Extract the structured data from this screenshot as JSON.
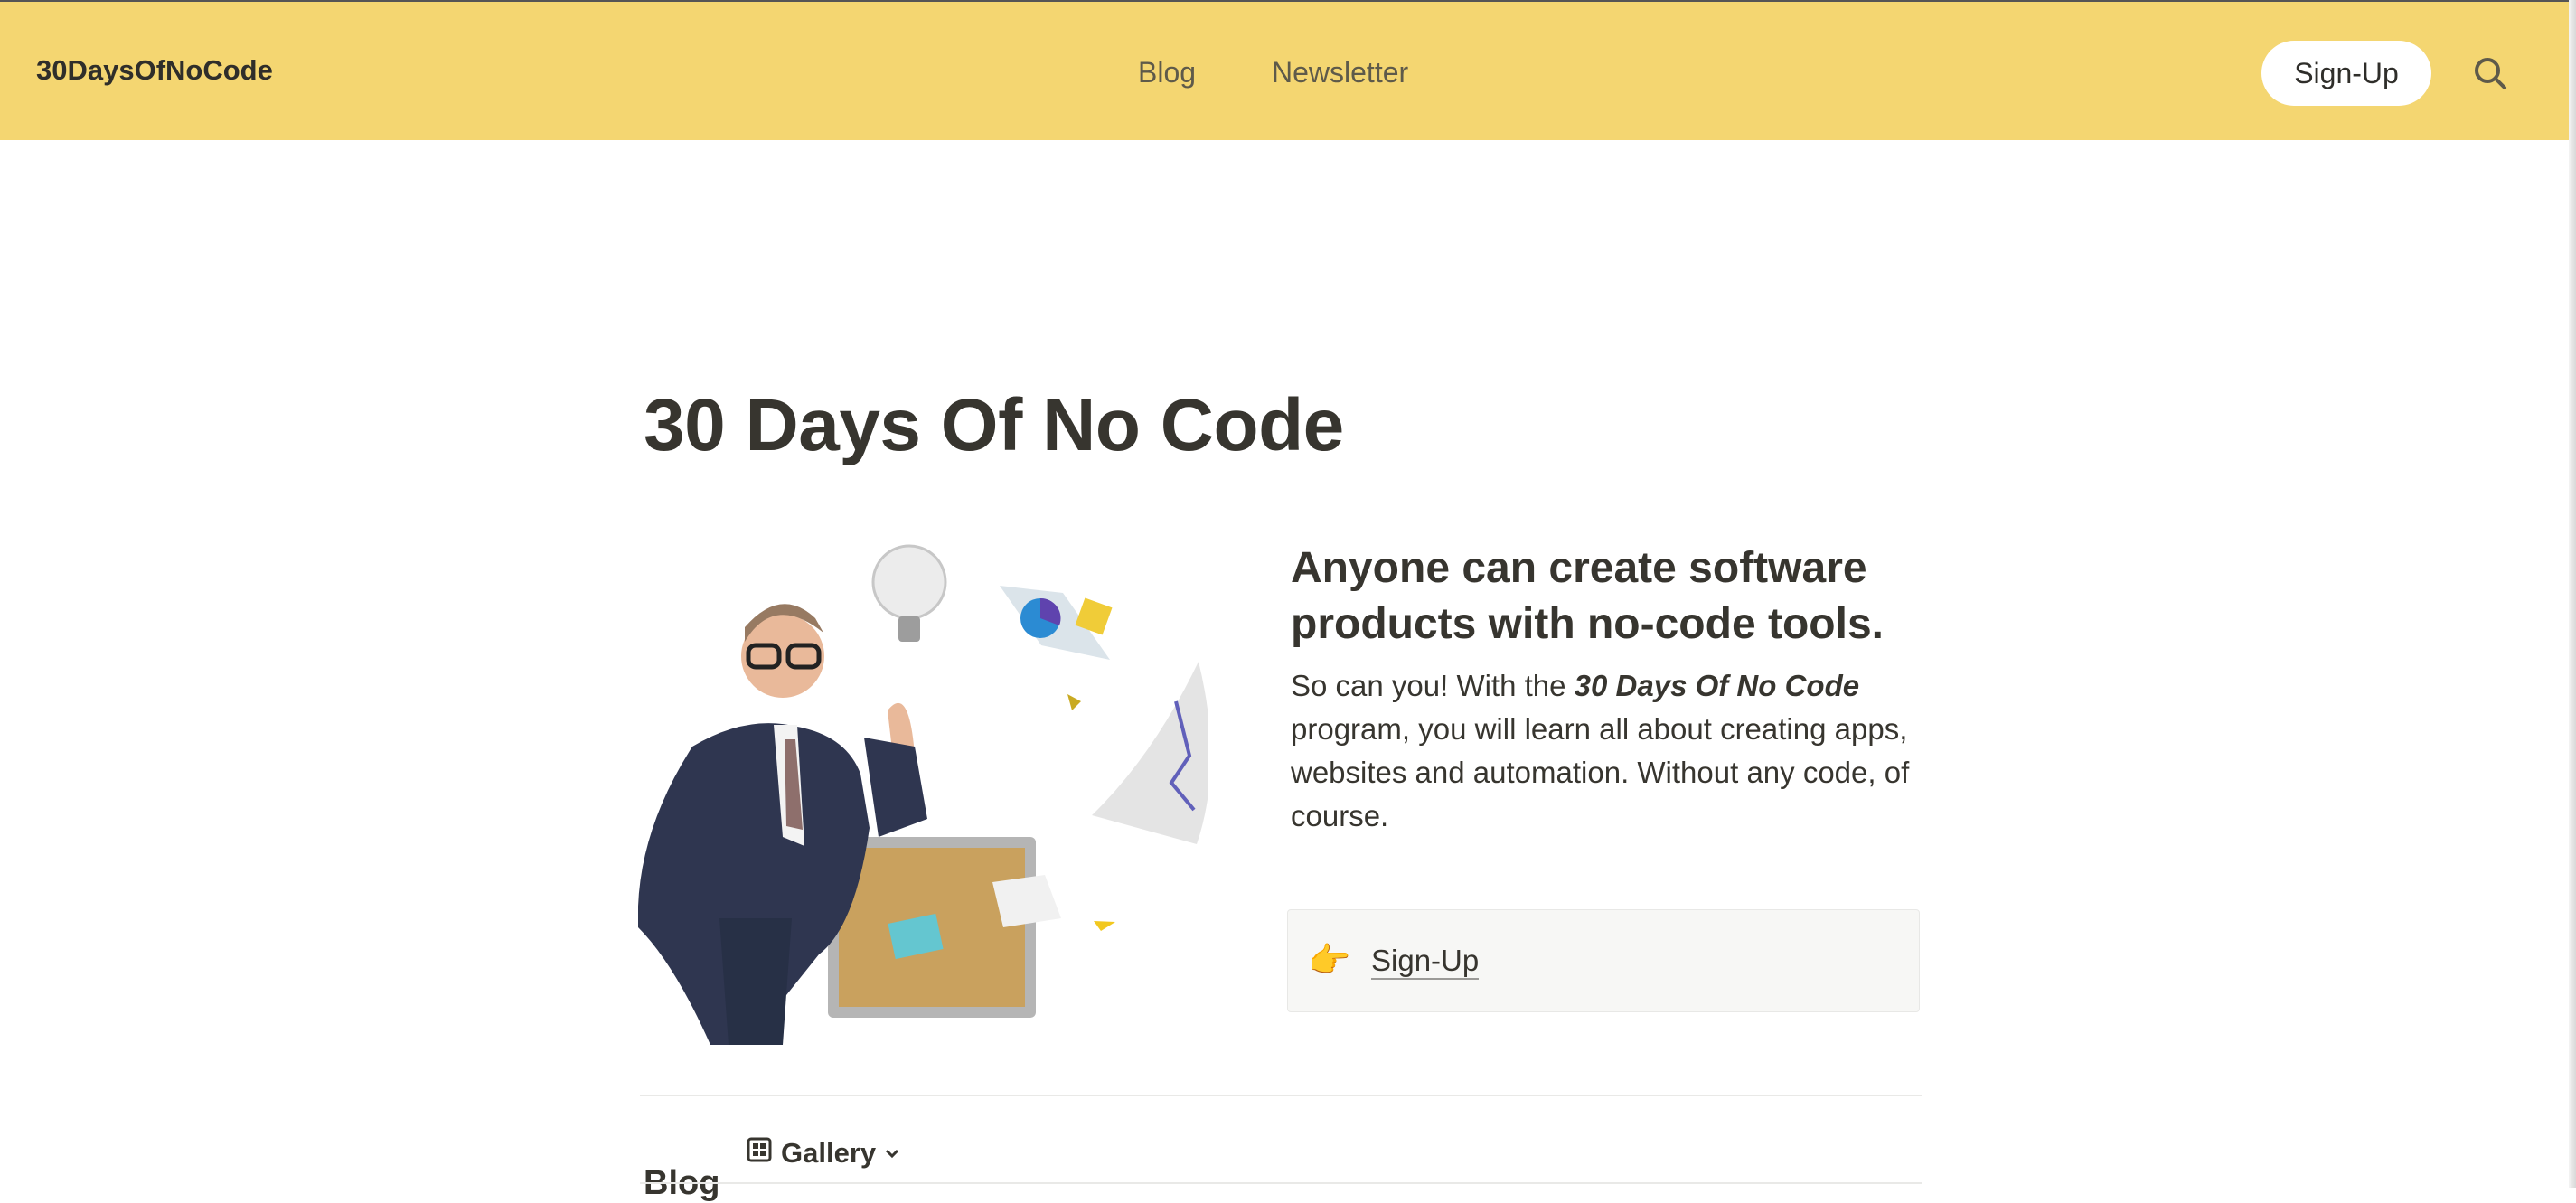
{
  "header": {
    "brand": "30DaysOfNoCode",
    "nav": [
      "Blog",
      "Newsletter"
    ],
    "signup_label": "Sign-Up",
    "search_icon": "search-icon"
  },
  "hero": {
    "title": "30 Days Of No Code",
    "headline": "Anyone can create software products with no-code tools.",
    "body_before": "So can you! With the ",
    "body_emphasis": "30 Days Of No Code",
    "body_after": " program, you will learn all about creating apps, websites and automation. Without any code, of course.",
    "callout_icon": "👉",
    "callout_link": "Sign-Up"
  },
  "blog": {
    "heading": "Blog",
    "view_label": "Gallery",
    "view_icon": "gallery-icon"
  },
  "colors": {
    "header_bg": "#f4d671",
    "text": "#37352f",
    "callout_bg": "#f7f7f5"
  }
}
